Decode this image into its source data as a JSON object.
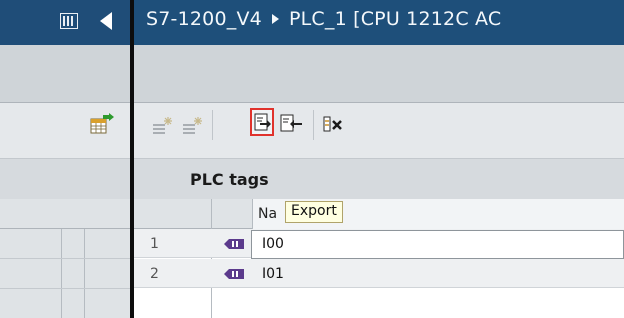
{
  "header": {
    "project": "S7-1200_V4",
    "device": "PLC_1 [CPU 1212C AC"
  },
  "toolbar": {
    "icons": [
      "add-tag-icon",
      "insert-row-icon",
      "export-icon",
      "import-icon",
      "delete-unused-icon",
      "table-export-icon"
    ],
    "export_highlight_color": "#e0322c"
  },
  "table": {
    "title": "PLC tags",
    "columns": [
      "Na"
    ],
    "tooltip": "Export",
    "rows": [
      {
        "num": "1",
        "name": "I00"
      },
      {
        "num": "2",
        "name": "I01"
      }
    ]
  },
  "colors": {
    "titlebar": "#1e4f7a",
    "tooltip_bg": "#ffffe1"
  }
}
